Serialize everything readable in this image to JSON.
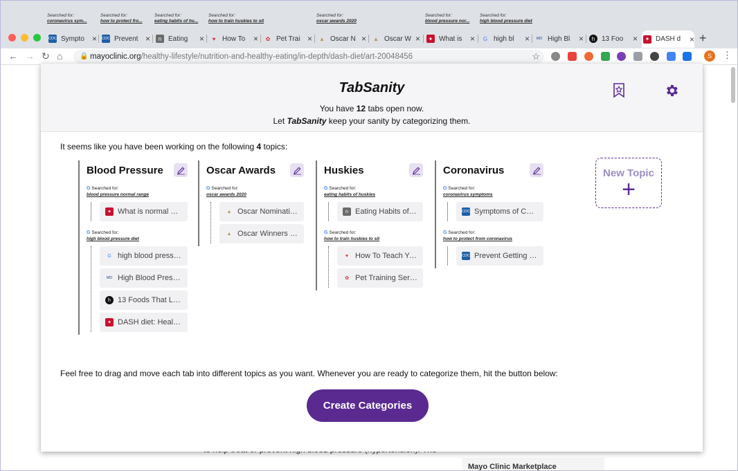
{
  "tab_annotations": [
    {
      "label": "Searched for:",
      "query": "coronavirus sym..."
    },
    {
      "label": "Searched for:",
      "query": "how to protect fro..."
    },
    {
      "label": "Searched for:",
      "query": "eating habits of hu..."
    },
    {
      "label": "Searched for:",
      "query": "how to train huskies to sit"
    },
    {
      "label": "Searched for:",
      "query": "oscar awards 2020"
    },
    {
      "label": "Searched for:",
      "query": "blood pressure nor..."
    },
    {
      "label": "Searched for:",
      "query": "high blood pressure diet"
    }
  ],
  "tabs": [
    {
      "title": "Sympto",
      "icon": "cdc-icon"
    },
    {
      "title": "Prevent",
      "icon": "cdc-icon"
    },
    {
      "title": "Eating",
      "icon": "n-icon"
    },
    {
      "title": "How To",
      "icon": "heart-icon"
    },
    {
      "title": "Pet Trai",
      "icon": "paw-icon"
    },
    {
      "title": "Oscar N",
      "icon": "oscar-icon"
    },
    {
      "title": "Oscar W",
      "icon": "oscar-icon"
    },
    {
      "title": "What is",
      "icon": "mayo-icon"
    },
    {
      "title": "high bl",
      "icon": "google-icon"
    },
    {
      "title": "High Bl",
      "icon": "webmd-icon"
    },
    {
      "title": "13 Foo",
      "icon": "h-icon"
    },
    {
      "title": "DASH d",
      "icon": "mayo-icon"
    }
  ],
  "address_bar": {
    "host": "mayoclinic.org",
    "path": "/healthy-lifestyle/nutrition-and-healthy-eating/in-depth/dash-diet/art-20048456"
  },
  "avatar_letter": "S",
  "background_page": {
    "text": "to help treat or prevent high blood pressure (hypertension). The",
    "sidebar_title": "Mayo Clinic Marketplace"
  },
  "popup": {
    "title": "TabSanity",
    "tab_count_prefix": "You have ",
    "tab_count": "12",
    "tab_count_suffix": " tabs open now.",
    "line2_prefix": "Let ",
    "line2_brand": "TabSanity",
    "line2_suffix": " keep your sanity by categorizing them.",
    "intro_prefix": "It seems like you have been working on the following ",
    "topic_count": "4",
    "intro_suffix": " topics:",
    "searched_label": "Searched for:",
    "topics": [
      {
        "name": "Blood Pressure",
        "groups": [
          {
            "query": "blood pressure normal range",
            "items": [
              {
                "title": "What is normal blo...",
                "icon": "mayo-icon"
              }
            ]
          },
          {
            "query": "high blood pressure diet",
            "items": [
              {
                "title": "high blood pressur...",
                "icon": "google-icon"
              },
              {
                "title": "High Blood Pressu...",
                "icon": "webmd-icon"
              },
              {
                "title": "13 Foods That Low...",
                "icon": "h-icon"
              },
              {
                "title": "DASH diet: Healthy...",
                "icon": "mayo-icon"
              }
            ]
          }
        ]
      },
      {
        "name": "Oscar Awards",
        "groups": [
          {
            "query": "oscar awards 2020",
            "items": [
              {
                "title": "Oscar Nominations...",
                "icon": "oscar-icon"
              },
              {
                "title": "Oscar Winners 202...",
                "icon": "oscar-icon"
              }
            ]
          }
        ]
      },
      {
        "name": "Huskies",
        "groups": [
          {
            "query": "eating habits of huskies",
            "items": [
              {
                "title": "Eating Habits of Si...",
                "icon": "n-icon"
              }
            ]
          },
          {
            "query": "how to train huskies to sit",
            "items": [
              {
                "title": "How To Teach You...",
                "icon": "heart-icon"
              },
              {
                "title": "Pet Training Series:...",
                "icon": "paw-icon"
              }
            ]
          }
        ]
      },
      {
        "name": "Coronavirus",
        "groups": [
          {
            "query": "coronavirus symptoms",
            "items": [
              {
                "title": "Symptoms of Coro...",
                "icon": "cdc-icon"
              }
            ]
          },
          {
            "query": "how to protect from coronavirus",
            "items": [
              {
                "title": "Prevent Getting Si...",
                "icon": "cdc-icon"
              }
            ]
          }
        ]
      }
    ],
    "new_topic_label": "New Topic",
    "hint": "Feel free to drag and move each tab into different topics as you want. Whenever you are ready to categorize them, hit the button below:",
    "cta_label": "Create Categories"
  },
  "colors": {
    "accent": "#5a2a90",
    "edit_bg": "#e6e0f2",
    "item_bg": "#f1f1f4"
  }
}
